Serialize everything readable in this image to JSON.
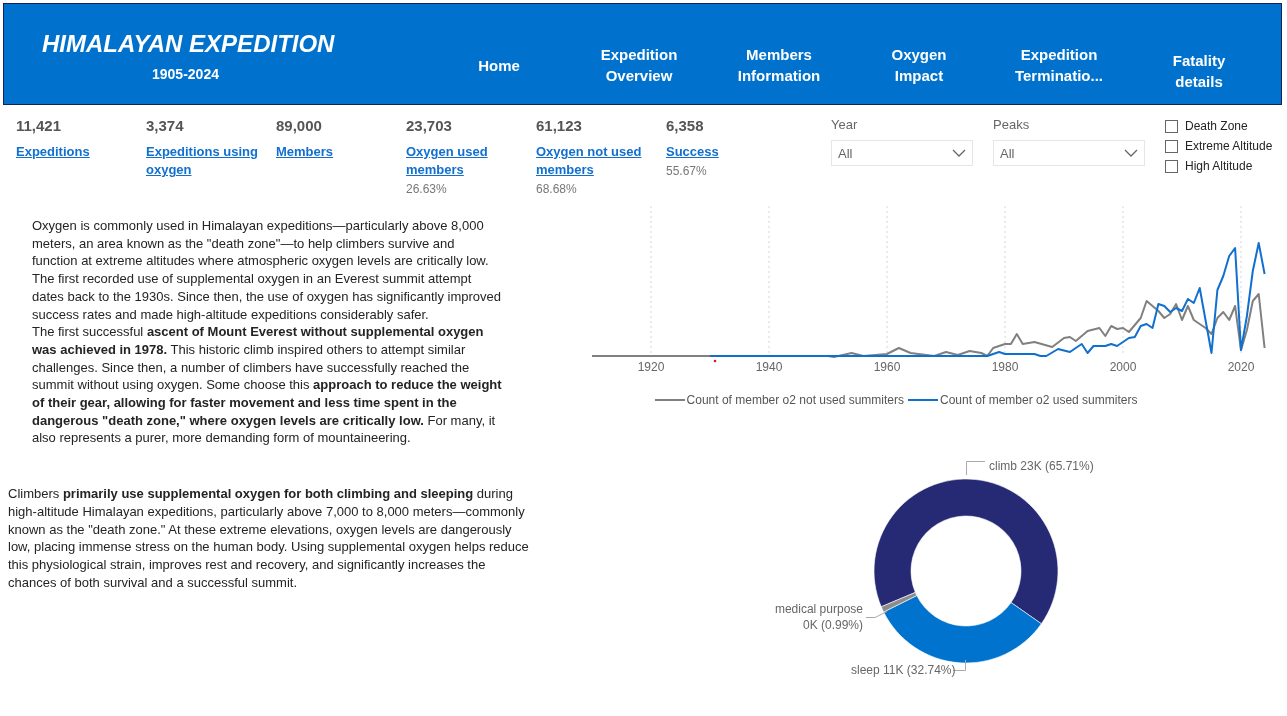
{
  "header": {
    "title": "HIMALAYAN EXPEDITION",
    "subtitle": "1905-2024",
    "nav": [
      {
        "label": "Home"
      },
      {
        "label": "Expedition Overview"
      },
      {
        "label": "Members Information"
      },
      {
        "label": "Oxygen Impact"
      },
      {
        "label": "Expedition Terminatio..."
      },
      {
        "label": "Fatality details"
      }
    ]
  },
  "kpis": [
    {
      "value": "11,421",
      "label": "Expeditions"
    },
    {
      "value": "3,374",
      "label": "Expeditions using oxygen"
    },
    {
      "value": "89,000",
      "label": "Members"
    },
    {
      "value": "23,703",
      "label": "Oxygen used members",
      "percent": "26.63%"
    },
    {
      "value": "61,123",
      "label": "Oxygen not used members",
      "percent": "68.68%"
    },
    {
      "value": "6,358",
      "label": "Success",
      "percent": "55.67%"
    }
  ],
  "filters": [
    {
      "label": "Year",
      "value": "All"
    },
    {
      "label": "Peaks",
      "value": "All"
    }
  ],
  "zones": [
    {
      "label": "Death Zone",
      "checked": false
    },
    {
      "label": "Extreme Altitude",
      "checked": false
    },
    {
      "label": "High Altitude",
      "checked": false
    }
  ],
  "text_top": [
    "Oxygen is commonly used in Himalayan expeditions—particularly above 8,000 meters, an area known as the \"death zone\"—to help climbers survive and function at extreme altitudes where atmospheric oxygen levels are critically low. The first recorded use of supplemental oxygen in an Everest summit attempt dates back to the 1930s. Since then, the use of oxygen has significantly improved success rates and made high-altitude expeditions considerably safer.",
    "The first successful **ascent of Mount Everest without supplemental oxygen was achieved in 1978.** This historic climb inspired others to attempt similar challenges. Since then, a number of climbers have successfully reached the summit without using oxygen. Some choose this **approach to reduce the weight of their gear, allowing for faster movement and less time spent in the dangerous \"death zone,\" where oxygen levels are critically low.** For many, it also represents a purer, more demanding form of mountaineering."
  ],
  "text_bottom": "Climbers **primarily use supplemental oxygen for both climbing and sleeping** during high-altitude Himalayan expeditions, particularly above 7,000 to 8,000 meters—commonly known as the \"death zone.\" At these extreme elevations, oxygen levels are dangerously low, placing immense stress on the human body. Using supplemental oxygen helps reduce this physiological strain, improves rest and recovery, and significantly increases the chances of both survival and a successful summit.",
  "line_chart": {
    "xticks": [
      "1920",
      "1940",
      "1960",
      "1980",
      "2000",
      "2020"
    ],
    "legend": [
      {
        "name": "Count of member o2 not used summiters",
        "color": "#808080"
      },
      {
        "name": "Count of member o2 used summiters",
        "color": "#1170cf"
      }
    ]
  },
  "donut": {
    "chart_data": {
      "type": "donut",
      "categories": [
        "climb",
        "sleep",
        "medical purpose"
      ],
      "values": [
        65.71,
        32.74,
        0.99
      ],
      "value_labels": [
        "23K (65.71%)",
        "11K (32.74%)",
        "0K (0.99%)"
      ]
    },
    "slices": [
      {
        "color": "#262a74"
      },
      {
        "color": "#0073cf"
      },
      {
        "color": "#8c8c8c"
      }
    ]
  }
}
